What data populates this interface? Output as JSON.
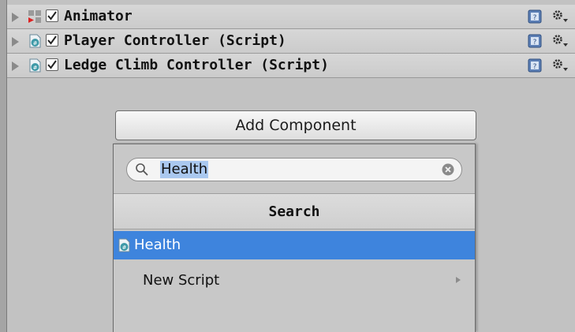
{
  "components": [
    {
      "name": "Animator",
      "icon": "animator-icon"
    },
    {
      "name": "Player Controller (Script)",
      "icon": "csharp-script-icon"
    },
    {
      "name": "Ledge Climb Controller (Script)",
      "icon": "csharp-script-icon"
    }
  ],
  "add_component": {
    "label": "Add Component"
  },
  "popup": {
    "search_value": "Health",
    "header": "Search",
    "results": [
      {
        "label": "Health",
        "icon": "csharp-script-icon",
        "selected": true
      },
      {
        "label": "New Script",
        "has_submenu": true
      }
    ]
  },
  "colors": {
    "selection": "#3e84dd",
    "text_highlight": "#aac8ef"
  }
}
